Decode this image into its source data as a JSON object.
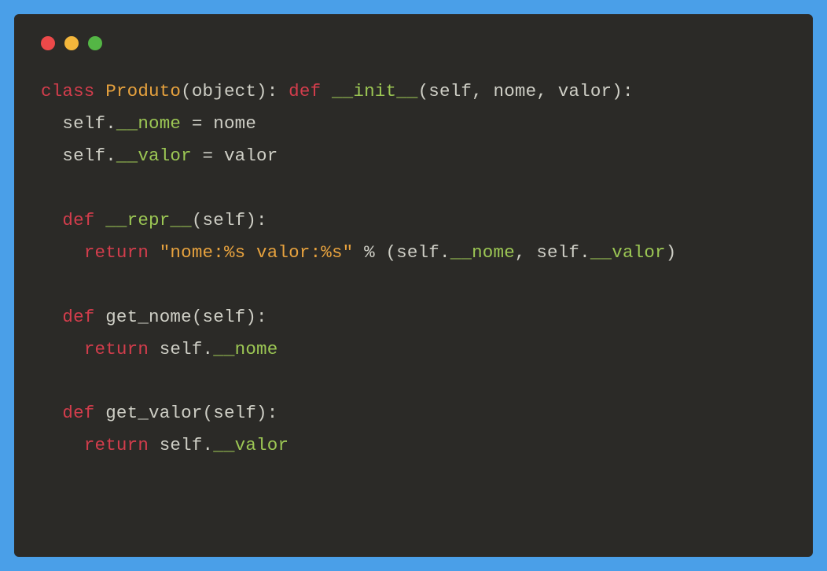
{
  "code": {
    "line1": {
      "keyword1": "class",
      "classname": "Produto",
      "paren_open": "(object): ",
      "keyword2": "def",
      "space1": " ",
      "attr1": "__init__",
      "params": "(self, nome, valor):"
    },
    "line2": {
      "indent": "  self.",
      "attr": "__nome",
      "rest": " = nome"
    },
    "line3": {
      "indent": "  self.",
      "attr": "__valor",
      "rest": " = valor"
    },
    "line5": {
      "indent": "  ",
      "keyword": "def",
      "space": " ",
      "attr": "__repr__",
      "params": "(self):"
    },
    "line6": {
      "indent": "    ",
      "keyword": "return",
      "space": " ",
      "string": "\"nome:%s valor:%s\"",
      "mid": " % (self.",
      "attr1": "__nome",
      "sep": ", self.",
      "attr2": "__valor",
      "close": ")"
    },
    "line8": {
      "indent": "  ",
      "keyword": "def",
      "funcname": " get_nome(self):"
    },
    "line9": {
      "indent": "    ",
      "keyword": "return",
      "mid": " self.",
      "attr": "__nome"
    },
    "line11": {
      "indent": "  ",
      "keyword": "def",
      "funcname": " get_valor(self):"
    },
    "line12": {
      "indent": "    ",
      "keyword": "return",
      "mid": " self.",
      "attr": "__valor"
    }
  }
}
